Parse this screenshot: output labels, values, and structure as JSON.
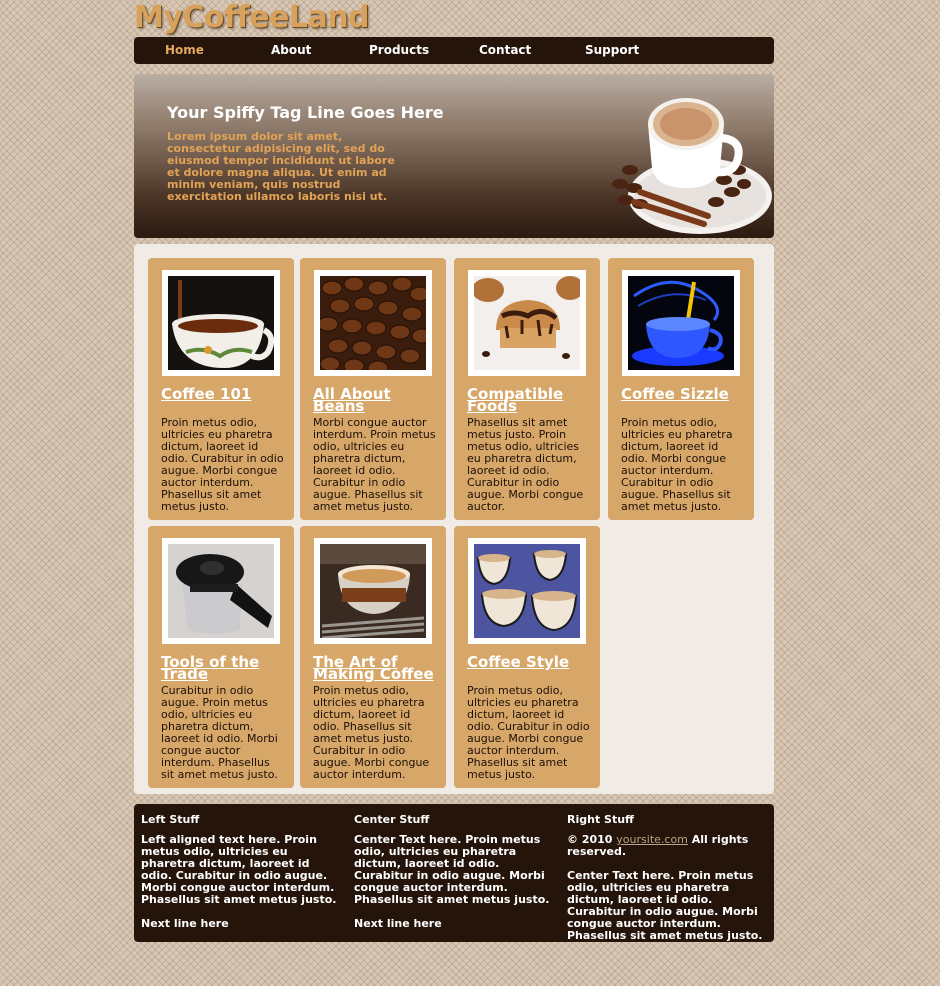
{
  "site": {
    "logo": "MyCoffeeLand"
  },
  "nav": {
    "items": [
      {
        "label": "Home",
        "active": true
      },
      {
        "label": "About",
        "active": false
      },
      {
        "label": "Products",
        "active": false
      },
      {
        "label": "Contact",
        "active": false
      },
      {
        "label": "Support",
        "active": false
      }
    ]
  },
  "hero": {
    "title": "Your Spiffy Tag Line Goes Here",
    "text": "Lorem ipsum dolor sit amet, consectetur adipisicing elit, sed do eiusmod tempor incididunt ut labore et dolore magna aliqua. Ut enim ad minim veniam, quis nostrud exercitation ullamco laboris nisi ut."
  },
  "cards": [
    {
      "title": "Coffee 101",
      "text": "Proin metus odio, ultricies eu pharetra dictum, laoreet id odio. Curabitur in odio augue. Morbi congue auctor interdum. Phasellus sit amet metus justo.",
      "image": "coffee-pour-image"
    },
    {
      "title": "All About Beans",
      "text": "Morbi congue auctor interdum. Proin metus odio, ultricies eu pharetra dictum, laoreet id odio. Curabitur in odio augue. Phasellus sit amet metus justo.",
      "image": "coffee-beans-image"
    },
    {
      "title": "Compatible Foods",
      "text": "Phasellus sit amet metus justo. Proin metus odio, ultricies eu pharetra dictum, laoreet id odio. Curabitur in odio augue. Morbi congue auctor.",
      "image": "muffin-image"
    },
    {
      "title": "Coffee Sizzle",
      "text": "Proin metus odio, ultricies eu pharetra dictum, laoreet id odio. Morbi congue auctor interdum. Curabitur in odio augue. Phasellus sit amet metus justo.",
      "image": "blue-cup-image"
    },
    {
      "title": "Tools of the Trade",
      "text": "Curabitur in odio augue. Proin metus odio, ultricies eu pharetra dictum, laoreet id odio. Morbi congue auctor interdum. Phasellus sit amet metus justo.",
      "image": "coffee-press-image"
    },
    {
      "title": "The Art of Making Coffee",
      "text": "Proin metus odio, ultricies eu pharetra dictum, laoreet id odio. Phasellus sit amet metus justo. Curabitur in odio augue. Morbi congue auctor interdum.",
      "image": "espresso-cup-image"
    },
    {
      "title": "Coffee Style",
      "text": "Proin metus odio, ultricies eu pharetra dictum, laoreet id odio. Curabitur in odio augue. Morbi congue auctor interdum. Phasellus sit amet metus justo.",
      "image": "striped-cups-image"
    }
  ],
  "footer": {
    "left": {
      "heading": "Left Stuff",
      "text": "Left aligned text here. Proin metus odio, ultricies eu pharetra dictum, laoreet id odio. Curabitur in odio augue. Morbi congue auctor interdum. Phasellus sit amet metus justo.",
      "next": "Next line here"
    },
    "center": {
      "heading": "Center Stuff",
      "text": "Center Text here. Proin metus odio, ultricies eu pharetra dictum, laoreet id odio. Curabitur in odio augue. Morbi congue auctor interdum. Phasellus sit amet metus justo.",
      "next": "Next line here"
    },
    "right": {
      "heading": "Right Stuff",
      "copyright_prefix": "© 2010",
      "link": "yoursite.com",
      "copyright_suffix": "All rights reserved.",
      "text": "Center Text here. Proin metus odio, ultricies eu pharetra dictum, laoreet id odio. Curabitur in odio augue. Morbi congue auctor interdum. Phasellus sit amet metus justo."
    }
  },
  "colors": {
    "accent": "#e5a861",
    "nav_bg": "#241409",
    "card_bg": "#d6a769",
    "content_bg": "#f1ebe6"
  }
}
